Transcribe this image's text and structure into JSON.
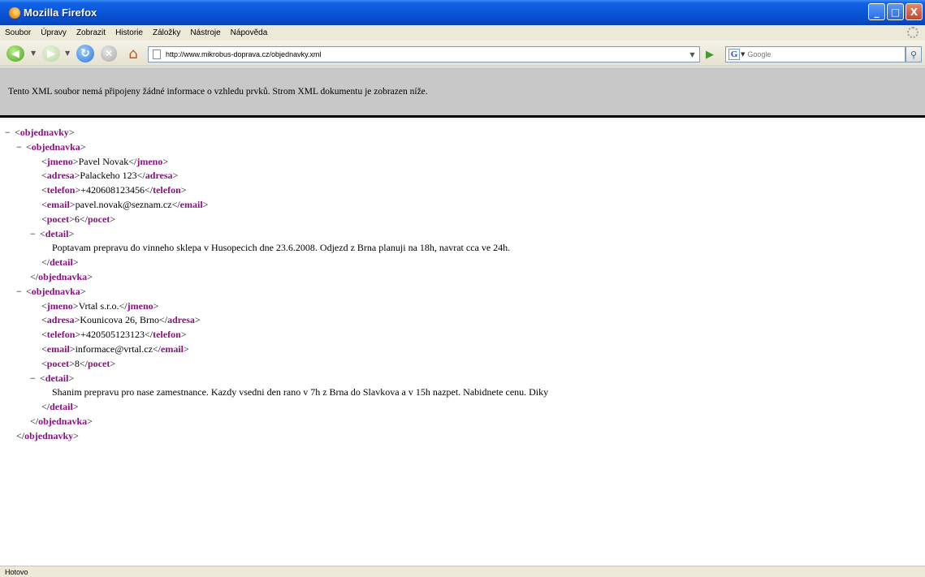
{
  "window": {
    "title": "Mozilla Firefox",
    "controls": {
      "minimize": "_",
      "maximize": "□",
      "close": "X"
    }
  },
  "menu": {
    "items": [
      "Soubor",
      "Úpravy",
      "Zobrazit",
      "Historie",
      "Záložky",
      "Nástroje",
      "Nápověda"
    ]
  },
  "toolbar": {
    "back_icon": "◀",
    "forward_icon": "▶",
    "reload_icon": "↻",
    "stop_icon": "✕",
    "home_icon": "⌂",
    "url": "http://www.mikrobus-doprava.cz/objednavky.xml",
    "go_icon": "▶",
    "search_engine": "G",
    "search_placeholder": "Google",
    "search_icon": "⚲"
  },
  "xml_info": {
    "message": "Tento XML soubor nemá připojeny žádné informace o vzhledu prvků. Strom XML dokumentu je zobrazen níže."
  },
  "xml_document": {
    "root": "objednavky",
    "item_tag": "objednavka",
    "toggle": "−",
    "orders": [
      {
        "jmeno": "Pavel Novak",
        "adresa": "Palackeho 123",
        "telefon": "+420608123456",
        "email": "pavel.novak@seznam.cz",
        "pocet": "6",
        "detail": "Poptavam prepravu do vinneho sklepa v Husopecich dne 23.6.2008. Odjezd z Brna planuji na 18h, navrat cca ve 24h."
      },
      {
        "jmeno": "Vrtal s.r.o.",
        "adresa": "Kounicova 26, Brno",
        "telefon": "+420505123123",
        "email": "informace@vrtal.cz",
        "pocet": "8",
        "detail": "Shanim prepravu pro nase zamestnance. Kazdy vsedni den rano v 7h z Brna do Slavkova a v 15h nazpet. Nabidnete cenu. Diky"
      }
    ]
  },
  "status": {
    "text": "Hotovo"
  },
  "colors": {
    "titlebar": "#0a55d8",
    "xml_tag": "#881280",
    "info_banner": "#c8c8c8",
    "chrome": "#ece9d8"
  }
}
